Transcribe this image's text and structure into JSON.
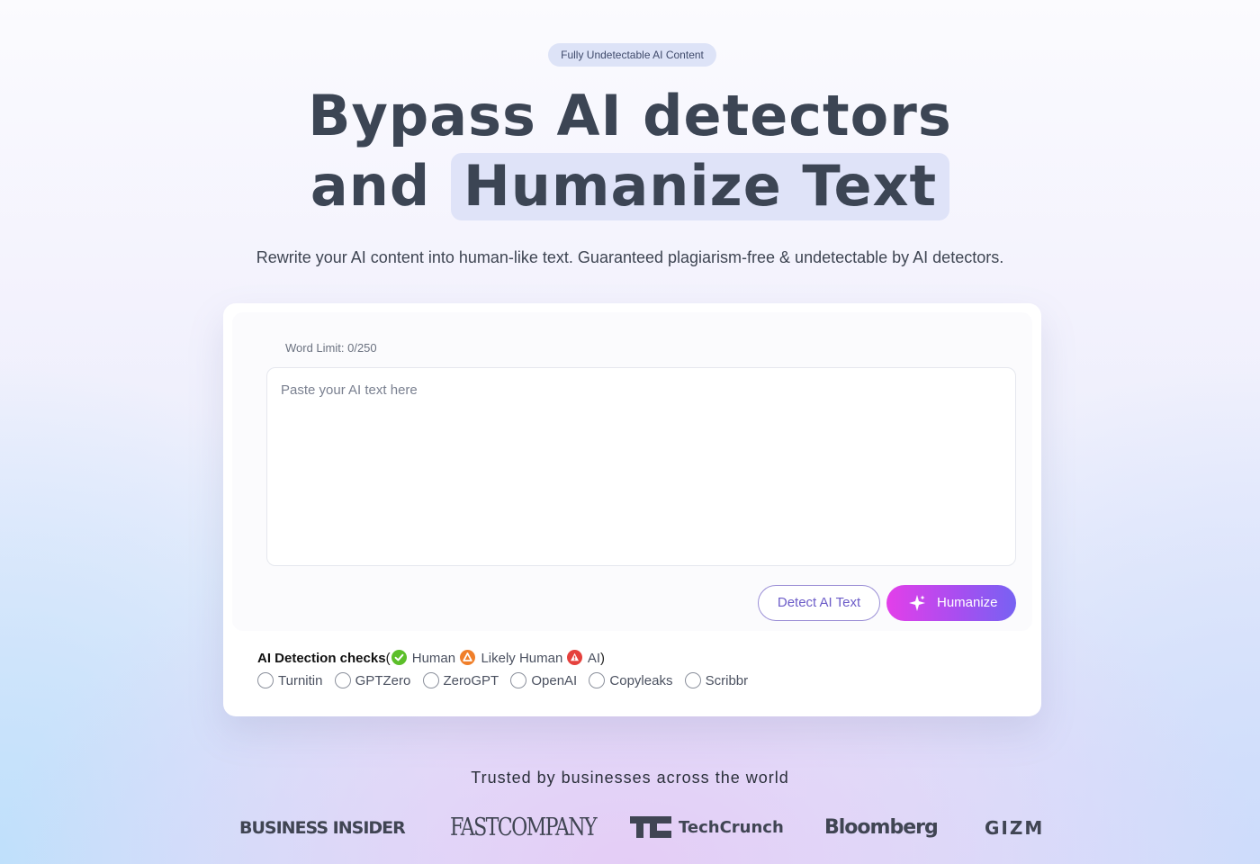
{
  "badge": "Fully Undetectable AI Content",
  "hero": {
    "line1": "Bypass AI detectors",
    "line2_prefix": "and",
    "line2_highlight": "Humanize Text"
  },
  "subtitle": "Rewrite your AI content into human-like text. Guaranteed plagiarism-free & undetectable by AI detectors.",
  "editor": {
    "word_limit": "Word Limit: 0/250",
    "placeholder": "Paste your AI text here",
    "value": ""
  },
  "buttons": {
    "detect": "Detect AI Text",
    "humanize": "Humanize"
  },
  "checks": {
    "title": "AI Detection checks",
    "open_paren": "(",
    "close_paren": ")",
    "legend": [
      {
        "label": "Human",
        "icon": "check-circle-icon",
        "color": "#5cbf2a"
      },
      {
        "label": "Likely Human",
        "icon": "warning-triangle-icon",
        "color": "#f07f2a"
      },
      {
        "label": "AI",
        "icon": "alert-triangle-icon",
        "color": "#e5413d"
      }
    ],
    "detectors": [
      "Turnitin",
      "GPTZero",
      "ZeroGPT",
      "OpenAI",
      "Copyleaks",
      "Scribbr"
    ]
  },
  "trusted": {
    "heading": "Trusted by businesses across the world",
    "logos": [
      "BUSINESS INSIDER",
      "FASTCOMPANY",
      "TechCrunch",
      "Bloomberg",
      "GIZMODO"
    ]
  },
  "colors": {
    "accent_start": "#e33fe9",
    "accent_end": "#7762f2",
    "heading": "#3c4554",
    "highlight_bg": "#dfe3f8"
  }
}
